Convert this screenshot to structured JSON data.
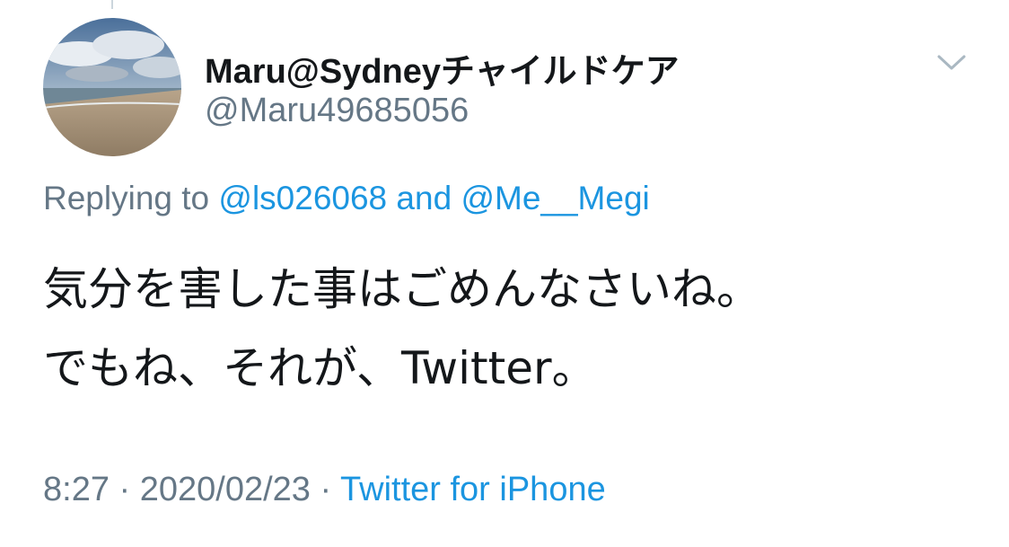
{
  "tweet": {
    "display_name": "Maru@Sydneyチャイルドケア",
    "handle": "@Maru49685056",
    "replying_prefix": "Replying to",
    "reply_mention_1": "@ls026068",
    "reply_conjunction": "and",
    "reply_mention_2": "@Me__Megi",
    "text_line_1": "気分を害した事はごめんなさいね。",
    "text_line_2": "でもね、それが、Twitter。",
    "time": "8:27",
    "separator": "·",
    "date": "2020/02/23",
    "source": "Twitter for iPhone"
  },
  "icons": {
    "menu": "chevron-down-icon"
  },
  "colors": {
    "primary_text": "#14171a",
    "secondary_text": "#657786",
    "link": "#1b95e0"
  }
}
